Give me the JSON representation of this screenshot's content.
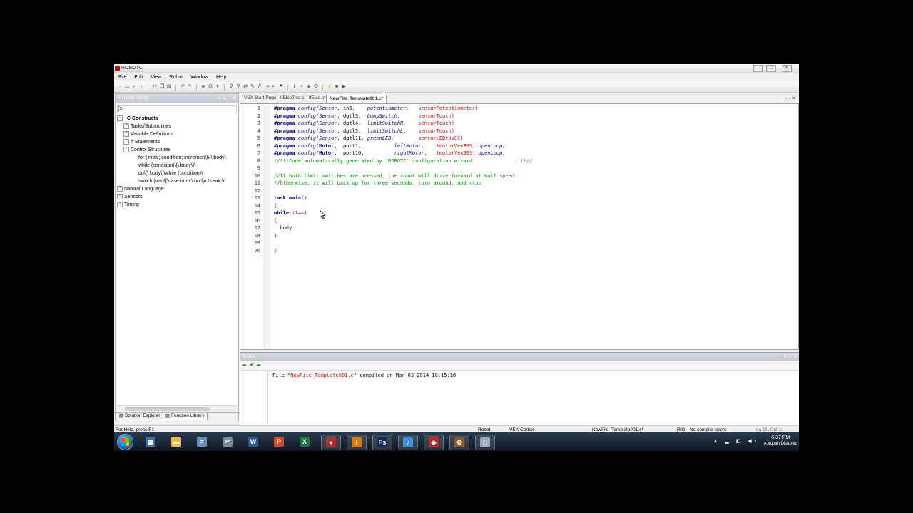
{
  "window": {
    "title": "ROBOTC",
    "controls": {
      "minimize": "–",
      "maximize": "□",
      "close": "✕"
    }
  },
  "menu": [
    "File",
    "Edit",
    "View",
    "Robot",
    "Window",
    "Help"
  ],
  "left_panel": {
    "title": "Function Library",
    "filter": "{s ·",
    "tree": [
      {
        "label": "_C Constructs",
        "level": 0,
        "expander": "−",
        "bold": true
      },
      {
        "label": "Tasks/Subroutines",
        "level": 1,
        "expander": "+"
      },
      {
        "label": "Variable Definitions",
        "level": 1,
        "expander": "+"
      },
      {
        "label": "If Statements",
        "level": 1,
        "expander": "+"
      },
      {
        "label": "Control Structures",
        "level": 1,
        "expander": "−"
      },
      {
        "label": "for (initial; condition; increment)\\{\\  body\\",
        "level": 2,
        "expander": ""
      },
      {
        "label": "while (condition)\\{\\  body\\}\\",
        "level": 2,
        "expander": ""
      },
      {
        "label": "do\\{\\  body\\}\\while (condition)\\",
        "level": 2,
        "expander": ""
      },
      {
        "label": "switch (var)\\{\\case num:\\  body\\  break;\\d",
        "level": 2,
        "expander": ""
      },
      {
        "label": "Natural Language",
        "level": 0,
        "expander": "+"
      },
      {
        "label": "Sensors",
        "level": 0,
        "expander": "+"
      },
      {
        "label": "Timing",
        "level": 0,
        "expander": "+"
      }
    ],
    "tabs": {
      "solution": "Solution Explorer",
      "library": "Function Library"
    }
  },
  "editor": {
    "tabs": [
      "VEX Start Page",
      "IfElseTest.c",
      "IfElse.c*",
      "NewFile_Template001.c*"
    ],
    "active_tab": 3,
    "lines": [
      [
        [
          "#pragma",
          "kw"
        ],
        [
          " config(",
          "it"
        ],
        [
          "Sensor",
          "it"
        ],
        [
          ", in5,    ",
          "plain"
        ],
        [
          "potentiometer, ",
          "it"
        ],
        [
          "  sensorPotentiometer)",
          "red"
        ]
      ],
      [
        [
          "#pragma",
          "kw"
        ],
        [
          " config(",
          "it"
        ],
        [
          "Sensor",
          "it"
        ],
        [
          ", dgtl3,  ",
          "plain"
        ],
        [
          "bumpSwitch,   ",
          "it"
        ],
        [
          "   sensorTouch)",
          "red"
        ]
      ],
      [
        [
          "#pragma",
          "kw"
        ],
        [
          " config(",
          "it"
        ],
        [
          "Sensor",
          "it"
        ],
        [
          ", dgtl4,  ",
          "plain"
        ],
        [
          "limitSwitchR, ",
          "it"
        ],
        [
          "   sensorTouch)",
          "red"
        ]
      ],
      [
        [
          "#pragma",
          "kw"
        ],
        [
          " config(",
          "it"
        ],
        [
          "Sensor",
          "it"
        ],
        [
          ", dgtl5,  ",
          "plain"
        ],
        [
          "limitSwitchL, ",
          "it"
        ],
        [
          "   sensorTouch)",
          "red"
        ]
      ],
      [
        [
          "#pragma",
          "kw"
        ],
        [
          " config(",
          "it"
        ],
        [
          "Sensor",
          "it"
        ],
        [
          ", dgtl11, ",
          "plain"
        ],
        [
          "greenLED,     ",
          "it"
        ],
        [
          "   sensorLEDtoVCC)",
          "red"
        ]
      ],
      [
        [
          "#pragma",
          "kw"
        ],
        [
          " config(",
          "it"
        ],
        [
          "Motor",
          "kw"
        ],
        [
          ",  port1,           ",
          "plain"
        ],
        [
          "leftMotor,    ",
          "it"
        ],
        [
          "tmotorVex393, ",
          "red"
        ],
        [
          "openLoop)",
          "it"
        ]
      ],
      [
        [
          "#pragma",
          "kw"
        ],
        [
          " config(",
          "it"
        ],
        [
          "Motor",
          "kw"
        ],
        [
          ",  port10,          ",
          "plain"
        ],
        [
          "rightMotor,   ",
          "it"
        ],
        [
          "tmotorVex393, ",
          "red"
        ],
        [
          "openLoop)",
          "it"
        ]
      ],
      [
        [
          "//*!!Code automatically generated by 'ROBOTC' configuration wizard               !!*//",
          "cm"
        ]
      ],
      [
        [
          "",
          "plain"
        ]
      ],
      [
        [
          "//If both limit switches are pressed, the robot will drive forward at half speed",
          "cm"
        ]
      ],
      [
        [
          "//Otherwise, it will back up for three seconds, turn around, and stop",
          "cm"
        ]
      ],
      [
        [
          "",
          "plain"
        ]
      ],
      [
        [
          "task",
          "kw"
        ],
        [
          " main",
          "kw"
        ],
        [
          "()",
          "red"
        ]
      ],
      [
        [
          "{",
          "red"
        ]
      ],
      [
        [
          "while",
          "kw"
        ],
        [
          " (1==)",
          "red"
        ]
      ],
      [
        [
          "{",
          "red"
        ]
      ],
      [
        [
          "  body",
          "plain"
        ]
      ],
      [
        [
          "}",
          "red"
        ]
      ],
      [
        [
          "",
          "plain"
        ]
      ],
      [
        [
          "}",
          "red"
        ]
      ]
    ]
  },
  "errors_panel": {
    "title": "Errors",
    "msg_prefix": "File \"",
    "msg_file": "NewFile_Template001.c",
    "msg_suffix": "\" compiled on Mar 03 2014 18:15:18"
  },
  "status": {
    "help": "For Help, press F1",
    "robot": "Robot",
    "platform": "VEX-Cortex",
    "file": "NewFile_Template001.c*",
    "ro": "R/O",
    "compile": "No compile errors",
    "position": "Ln 15, Col 11"
  },
  "taskbar": {
    "apps": [
      {
        "icon": "calculator-icon",
        "glyph": "▦",
        "color": "#3a6ea5"
      },
      {
        "icon": "folder-icon",
        "glyph": "▬",
        "color": "#e8b84a"
      },
      {
        "icon": "notepad-icon",
        "glyph": "≡",
        "color": "#6a8fbf"
      },
      {
        "icon": "snipping-tool-icon",
        "glyph": "✂",
        "color": "#7a8898"
      },
      {
        "icon": "word-icon",
        "glyph": "W",
        "color": "#2b579a"
      },
      {
        "icon": "powerpoint-icon",
        "glyph": "P",
        "color": "#d24726"
      },
      {
        "icon": "excel-icon",
        "glyph": "X",
        "color": "#217346"
      },
      {
        "icon": "robotc-icon",
        "glyph": "●",
        "color": "#b03030"
      },
      {
        "icon": "app-i-icon",
        "glyph": "I",
        "color": "#e07a10"
      },
      {
        "icon": "photoshop-icon",
        "glyph": "Ps",
        "color": "#0d2d5a"
      },
      {
        "icon": "itunes-icon",
        "glyph": "♪",
        "color": "#3c8ed8"
      },
      {
        "icon": "app-red-icon",
        "glyph": "◆",
        "color": "#c0282a"
      },
      {
        "icon": "robotc-window-icon",
        "glyph": "⚙",
        "color": "#8a5a2a"
      },
      {
        "icon": "window-icon",
        "glyph": "□",
        "color": "#9aa8ba"
      }
    ],
    "time": "6:37 PM",
    "caption": "Autopan Disabled"
  }
}
